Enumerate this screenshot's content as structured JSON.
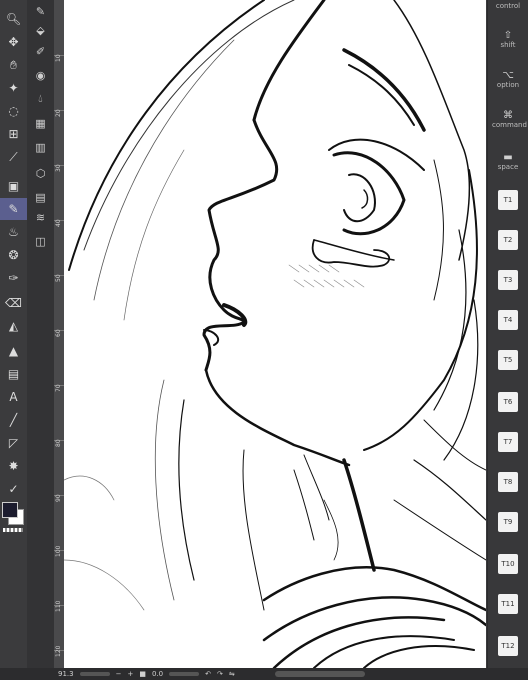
{
  "right_keys": {
    "control": "control",
    "shift": "shift",
    "option": "option",
    "command": "command",
    "space": "space",
    "t_keys": [
      "T1",
      "T2",
      "T3",
      "T4",
      "T5",
      "T6",
      "T7",
      "T8",
      "T9",
      "T10",
      "T11",
      "T12"
    ]
  },
  "ruler": {
    "labels": [
      "10",
      "20",
      "30",
      "40",
      "50",
      "60",
      "70",
      "80",
      "90",
      "100",
      "110",
      "120"
    ]
  },
  "bottom": {
    "zoom": "91.3",
    "angle": "0.0"
  },
  "colors": {
    "main": "#1c1c2e",
    "sub": "#ffffff",
    "accent": "#5b5f8f"
  },
  "icons": {
    "tools": [
      "zoom-icon",
      "move-icon",
      "hand-icon",
      "wand-icon",
      "lasso-icon",
      "grid-icon",
      "eyedropper-icon",
      "layer-move-icon",
      "pen-icon",
      "brush-icon",
      "airbrush-icon",
      "decoration-icon",
      "eraser-icon",
      "blend-icon",
      "gradient-icon",
      "text-icon",
      "line-icon",
      "figure-icon",
      "sparkle-icon",
      "correction-icon"
    ],
    "subtools": [
      "pen-sub-icon",
      "fill-sub-icon",
      "brush-sub-icon",
      "layer-sub-icon",
      "drop-sub-icon",
      "panel-sub-icon",
      "book-sub-icon",
      "layers-sub-icon",
      "frame-sub-icon"
    ]
  }
}
